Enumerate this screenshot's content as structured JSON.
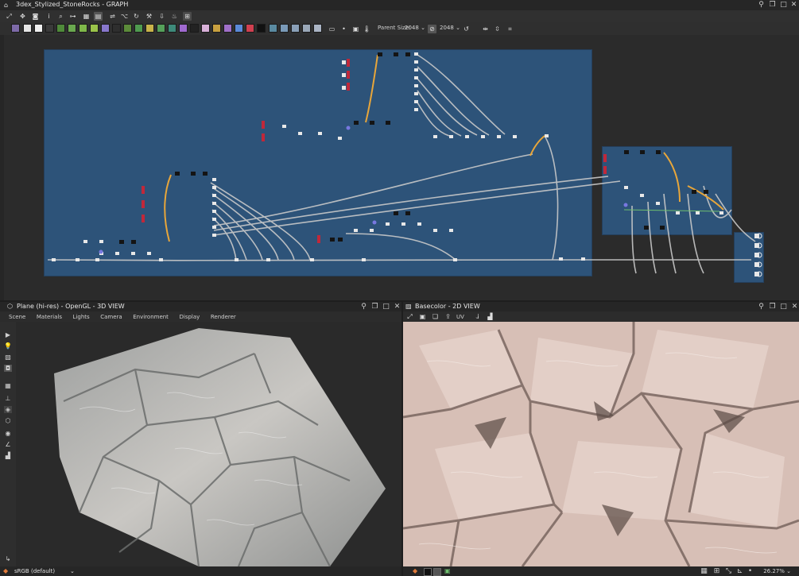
{
  "graph_window": {
    "title": "3dex_Stylized_StoneRocks - GRAPH",
    "parent_size_label": "Parent Size:",
    "parent_size_value": "2048",
    "output_size_value": "2048"
  },
  "view3d": {
    "title": "Plane (hi-res) - OpenGL - 3D VIEW",
    "menu": [
      "Scene",
      "Materials",
      "Lights",
      "Camera",
      "Environment",
      "Display",
      "Renderer"
    ],
    "colorspace": "sRGB (default)"
  },
  "view2d": {
    "title": "Basecolor - 2D VIEW",
    "uv_label": "UV",
    "zoom": "26.27%"
  },
  "colors": {
    "frame_blue": "#2d5379",
    "wire": "#c9c9c9",
    "wire_orange": "#e8a63a",
    "node_red": "#c0283a",
    "stone": "#c9c3bd",
    "basecolor": "#d7bfb6"
  }
}
